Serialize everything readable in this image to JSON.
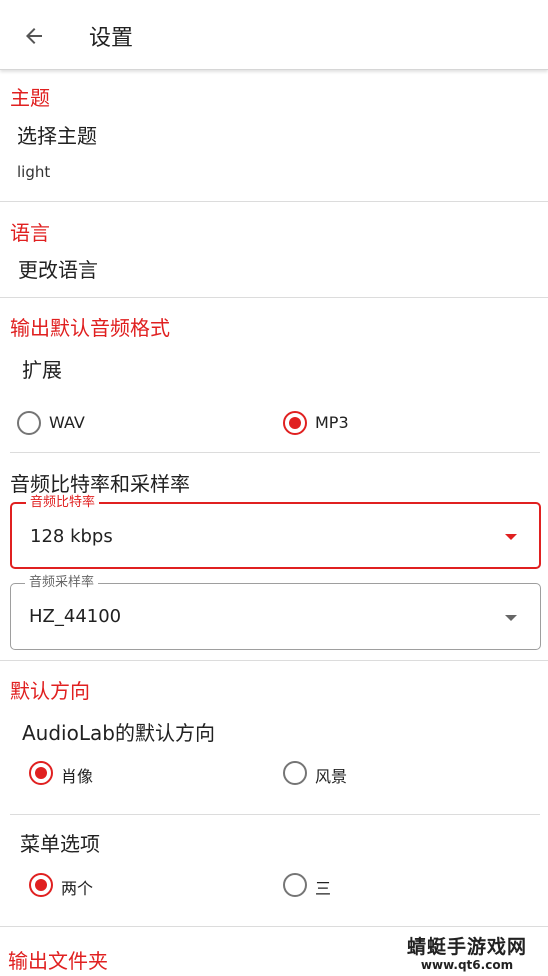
{
  "appbar": {
    "title": "设置",
    "back_icon": "arrow-left-icon"
  },
  "theme": {
    "section": "主题",
    "item": "选择主题",
    "value": "light"
  },
  "language": {
    "section": "语言",
    "item": "更改语言"
  },
  "output_format": {
    "section": "输出默认音频格式",
    "item": "扩展",
    "options": [
      {
        "label": "WAV",
        "checked": false
      },
      {
        "label": "MP3",
        "checked": true
      }
    ]
  },
  "bitrate_samplerate": {
    "title": "音频比特率和采样率",
    "bitrate": {
      "legend": "音频比特率",
      "value": "128 kbps"
    },
    "samplerate": {
      "legend": "音频采样率",
      "value": "HZ_44100"
    }
  },
  "orientation": {
    "section": "默认方向",
    "item": "AudioLab的默认方向",
    "options": [
      {
        "label": "肖像",
        "checked": true
      },
      {
        "label": "风景",
        "checked": false
      }
    ]
  },
  "menu_options": {
    "item": "菜单选项",
    "options": [
      {
        "label": "两个",
        "checked": true
      },
      {
        "label": "三",
        "checked": false
      }
    ]
  },
  "output_folder": {
    "section": "输出文件夹"
  },
  "watermark": {
    "title": "蜻蜓手游戏网",
    "url": "www.qt6.com"
  },
  "colors": {
    "accent": "#e02020",
    "divider": "#dcdcdc"
  }
}
